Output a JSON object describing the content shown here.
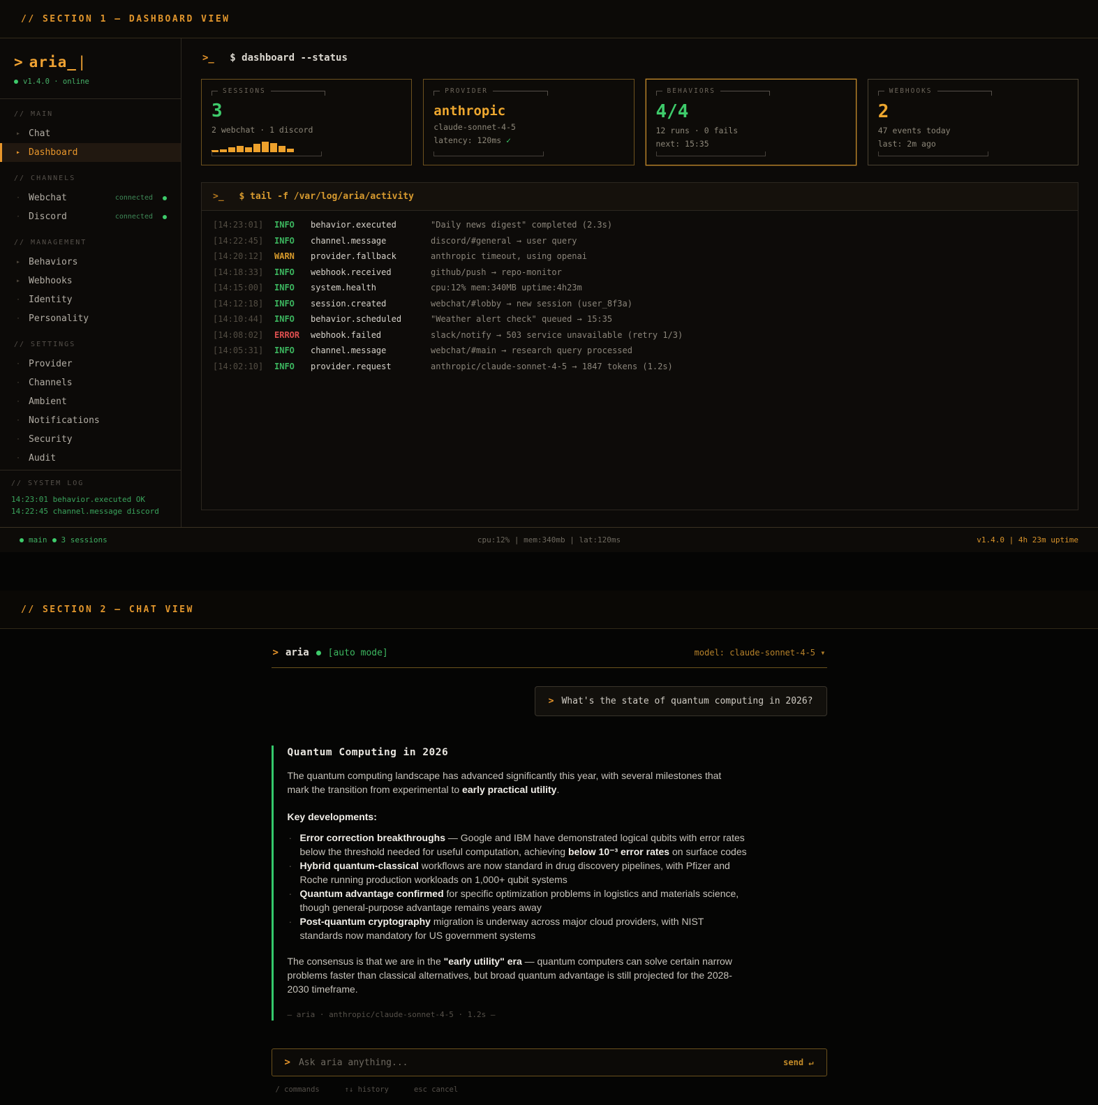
{
  "colors": {
    "accent_orange": "#e8962b",
    "green": "#3ecb6b",
    "warn_amber": "#d79a2b",
    "error_red": "#dd4f4f",
    "page_bg": "#0c0a08"
  },
  "section1": {
    "header": "// SECTION 1 — DASHBOARD VIEW",
    "sidebar": {
      "prompt": ">",
      "brand": "aria_",
      "cursor": "|",
      "version": "v1.4.0 · online",
      "groups": [
        {
          "label": "// MAIN",
          "items": [
            {
              "marker": "▸",
              "label": "Chat"
            },
            {
              "marker": "▸",
              "label": "Dashboard"
            }
          ]
        },
        {
          "label": "// CHANNELS",
          "items": [
            {
              "marker": "·",
              "label": "Webchat",
              "status": "connected"
            },
            {
              "marker": "·",
              "label": "Discord",
              "status": "connected"
            }
          ]
        },
        {
          "label": "// MANAGEMENT",
          "items": [
            {
              "marker": "▸",
              "label": "Behaviors"
            },
            {
              "marker": "▸",
              "label": "Webhooks"
            },
            {
              "marker": "·",
              "label": "Identity"
            },
            {
              "marker": "·",
              "label": "Personality"
            }
          ]
        },
        {
          "label": "// SETTINGS",
          "items": [
            {
              "marker": "·",
              "label": "Provider"
            },
            {
              "marker": "·",
              "label": "Channels"
            },
            {
              "marker": "·",
              "label": "Ambient"
            },
            {
              "marker": "·",
              "label": "Notifications"
            },
            {
              "marker": "·",
              "label": "Security"
            },
            {
              "marker": "·",
              "label": "Audit"
            }
          ]
        }
      ],
      "system_log": {
        "label": "// SYSTEM LOG",
        "entries": [
          "14:23:01 behavior.executed OK",
          "14:22:45 channel.message discord"
        ]
      }
    },
    "main": {
      "command_prompt": ">_",
      "command": "$ dashboard --status",
      "cards": [
        {
          "title": "SESSIONS",
          "value": "3",
          "sub1": "2 webchat · 1 discord",
          "sparkline": [
            2,
            3,
            5,
            7,
            5,
            9,
            11,
            10,
            7,
            4
          ]
        },
        {
          "title": "PROVIDER",
          "value": "anthropic",
          "sub1": "claude-sonnet-4-5",
          "sub2": "latency: 120ms",
          "check": "✓"
        },
        {
          "title": "BEHAVIORS",
          "value": "4/4",
          "sub1": "12 runs · 0 fails",
          "sub2": "next: 15:35"
        },
        {
          "title": "WEBHOOKS",
          "value": "2",
          "sub1": "47 events today",
          "sub2": "last: 2m ago"
        }
      ],
      "log_panel": {
        "command_prompt": ">_",
        "command": "$ tail -f /var/log/aria/activity",
        "entries": [
          {
            "time": "[14:23:01]",
            "level": "INFO",
            "event": "behavior.executed",
            "message": "\"Daily news digest\" completed (2.3s)"
          },
          {
            "time": "[14:22:45]",
            "level": "INFO",
            "event": "channel.message",
            "message": "discord/#general → user query"
          },
          {
            "time": "[14:20:12]",
            "level": "WARN",
            "event": "provider.fallback",
            "message": "anthropic timeout, using openai"
          },
          {
            "time": "[14:18:33]",
            "level": "INFO",
            "event": "webhook.received",
            "message": "github/push → repo-monitor"
          },
          {
            "time": "[14:15:00]",
            "level": "INFO",
            "event": "system.health",
            "message": "cpu:12% mem:340MB uptime:4h23m"
          },
          {
            "time": "[14:12:18]",
            "level": "INFO",
            "event": "session.created",
            "message": "webchat/#lobby → new session (user_8f3a)"
          },
          {
            "time": "[14:10:44]",
            "level": "INFO",
            "event": "behavior.scheduled",
            "message": "\"Weather alert check\" queued → 15:35"
          },
          {
            "time": "[14:08:02]",
            "level": "ERROR",
            "event": "webhook.failed",
            "message": "slack/notify → 503 service unavailable (retry 1/3)"
          },
          {
            "time": "[14:05:31]",
            "level": "INFO",
            "event": "channel.message",
            "message": "webchat/#main → research query processed"
          },
          {
            "time": "[14:02:10]",
            "level": "INFO",
            "event": "provider.request",
            "message": "anthropic/claude-sonnet-4-5 → 1847 tokens (1.2s)"
          }
        ]
      }
    },
    "statusbar": {
      "left1": "main",
      "left2": "3 sessions",
      "center": "cpu:12% | mem:340mb | lat:120ms",
      "right": "v1.4.0 | 4h 23m uptime"
    }
  },
  "section2": {
    "header": "// SECTION 2 — CHAT VIEW",
    "chat": {
      "prompt": ">",
      "agent": "aria",
      "mode": "[auto mode]",
      "model": "model: claude-sonnet-4-5",
      "model_caret": "▾",
      "user_message": "What's the state of quantum computing in 2026?",
      "assistant": {
        "title": "Quantum Computing in 2026",
        "intro_pre": "The quantum computing landscape has advanced significantly this year, with several milestones that mark the transition from experimental to ",
        "intro_bold": "early practical utility",
        "intro_post": ".",
        "key_heading": "Key developments:",
        "bullet_marker": "·",
        "bullets": [
          {
            "b1": "Error correction breakthroughs",
            "t1": " — Google and IBM have demonstrated logical qubits with error rates below the threshold needed for useful computation, achieving ",
            "b2": "below 10⁻³ error rates",
            "t2": " on surface codes"
          },
          {
            "b1": "Hybrid quantum-classical",
            "t1": " workflows are now standard in drug discovery pipelines, with Pfizer and Roche running production workloads on 1,000+ qubit systems"
          },
          {
            "b1": "Quantum advantage confirmed",
            "t1": " for specific optimization problems in logistics and materials science, though general-purpose advantage remains years away"
          },
          {
            "b1": "Post-quantum cryptography",
            "t1": " migration is underway across major cloud providers, with NIST standards now mandatory for US government systems"
          }
        ],
        "outro_pre": "The consensus is that we are in the ",
        "outro_bold": "\"early utility\" era",
        "outro_post": " — quantum computers can solve certain narrow problems faster than classical alternatives, but broad quantum advantage is still projected for the 2028-2030 timeframe.",
        "meta": "— aria · anthropic/claude-sonnet-4-5 · 1.2s —"
      },
      "input": {
        "placeholder": "Ask aria anything...",
        "send_label": "send ↵"
      },
      "hints": [
        "/ commands",
        "↑↓ history",
        "esc cancel"
      ]
    }
  }
}
